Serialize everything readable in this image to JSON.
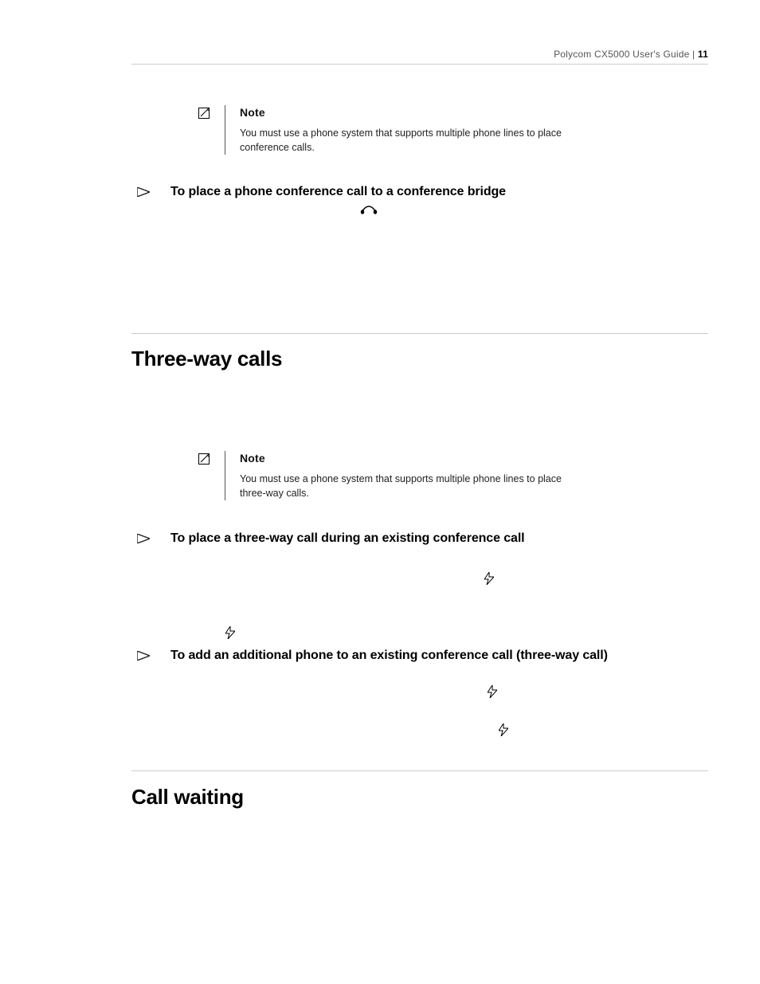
{
  "header": {
    "doc_title": "Polycom CX5000 User's Guide",
    "separator": " | ",
    "page_number": "11"
  },
  "notes": {
    "n1": {
      "title": "Note",
      "text": "You must use a phone system that supports multiple phone lines to place conference calls."
    },
    "n2": {
      "title": "Note",
      "text": "You must use a phone system that supports multiple phone lines to place three-way calls."
    }
  },
  "procedures": {
    "p1": "To place a phone conference call to a conference bridge",
    "p2": "To place a three-way call during an existing conference call",
    "p3": "To add an additional phone to an existing conference call (three-way call)"
  },
  "headings": {
    "h_threeway": "Three-way calls",
    "h_callwaiting": "Call waiting"
  }
}
